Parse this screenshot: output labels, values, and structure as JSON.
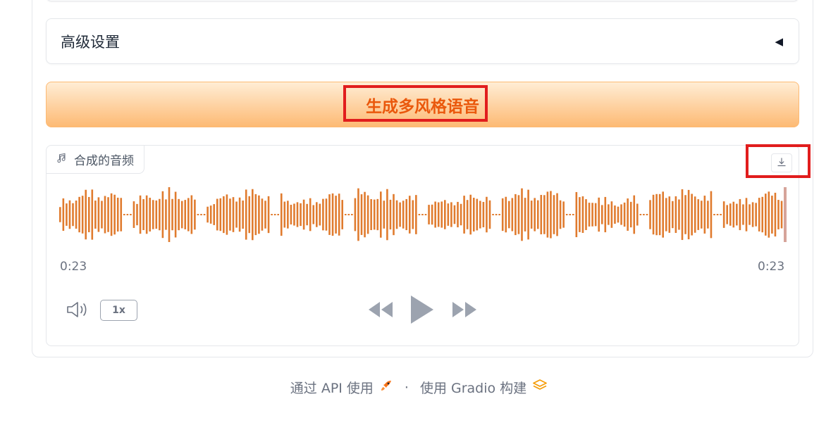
{
  "accordion": {
    "label": "高级设置",
    "caret_icon": "triangle-left-icon"
  },
  "generate_button": {
    "label": "生成多风格语音"
  },
  "audio": {
    "label": "合成的音频",
    "label_icon": "music-note-icon",
    "time_current": "0:23",
    "time_total": "0:23",
    "playback_rate": "1x",
    "progress": 1.0,
    "colors": {
      "wave": "#e07b2e",
      "progress_cursor": "#d6a49a"
    }
  },
  "footer": {
    "api_link": "通过 API 使用",
    "separator": "·",
    "built_with": "使用 Gradio 构建"
  },
  "colors": {
    "accent": "#ea580c",
    "button_gradient_top": "#ffedd5",
    "button_gradient_bottom": "#fdba74",
    "highlight": "#e11d1d"
  }
}
